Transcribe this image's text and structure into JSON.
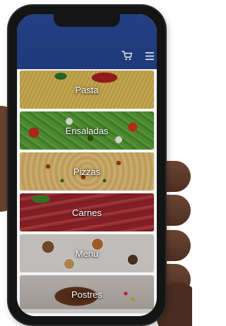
{
  "header": {
    "cart_icon": "cart-icon",
    "menu_icon": "hamburger-menu-icon",
    "color": "#243f82"
  },
  "menu": {
    "items": [
      {
        "label": "Pasta"
      },
      {
        "label": "Ensaladas"
      },
      {
        "label": "Pizzas"
      },
      {
        "label": "Carnes"
      },
      {
        "label": "Menú"
      },
      {
        "label": "Postres"
      }
    ]
  }
}
